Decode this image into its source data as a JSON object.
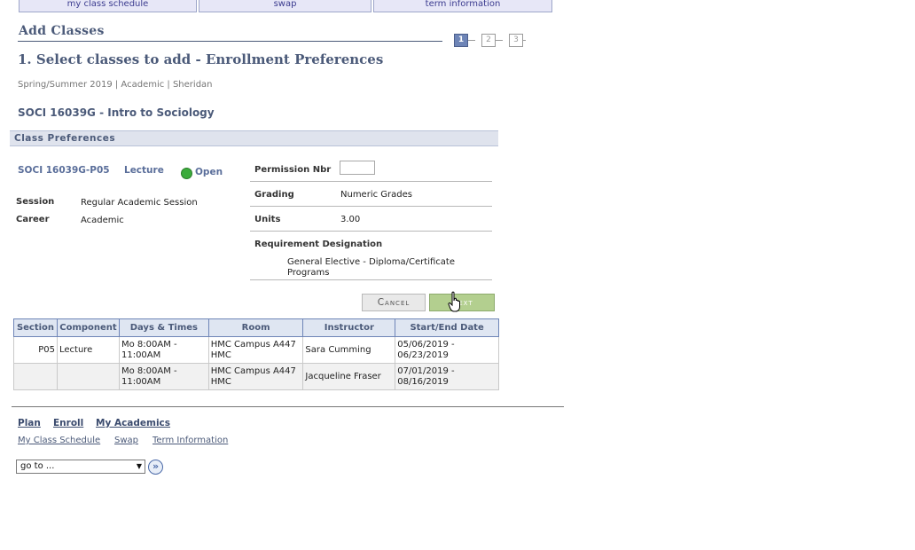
{
  "tabs": [
    {
      "label": "my class schedule"
    },
    {
      "label": "swap"
    },
    {
      "label": "term information"
    }
  ],
  "page": {
    "title": "Add Classes",
    "subtitle": "1.  Select classes to add - Enrollment Preferences",
    "term_line": "Spring/Summer 2019 | Academic | Sheridan",
    "course_title": "SOCI 16039G - Intro to Sociology"
  },
  "steps": [
    "1",
    "2",
    "3"
  ],
  "preferences": {
    "header": "Class Preferences",
    "section_link": "SOCI 16039G-P05",
    "component": "Lecture",
    "status": "Open",
    "session_label": "Session",
    "session_value": "Regular Academic Session",
    "career_label": "Career",
    "career_value": "Academic",
    "permission_label": "Permission Nbr",
    "grading_label": "Grading",
    "grading_value": "Numeric Grades",
    "units_label": "Units",
    "units_value": "3.00",
    "requirement_label": "Requirement Designation",
    "requirement_value": "General Elective - Diploma/Certificate Programs"
  },
  "buttons": {
    "cancel": "Cancel",
    "next": "Next"
  },
  "schedule": {
    "headers": [
      "Section",
      "Component",
      "Days & Times",
      "Room",
      "Instructor",
      "Start/End Date"
    ],
    "rows": [
      {
        "section": "P05",
        "component": "Lecture",
        "days_times": "Mo 8:00AM - 11:00AM",
        "room": "HMC Campus A447 HMC",
        "instructor": "Sara Cumming",
        "dates": "05/06/2019 - 06/23/2019"
      },
      {
        "section": "",
        "component": "",
        "days_times": "Mo 8:00AM - 11:00AM",
        "room": "HMC Campus A447 HMC",
        "instructor": "Jacqueline Fraser",
        "dates": "07/01/2019 - 08/16/2019"
      }
    ]
  },
  "footer_nav": {
    "primary": [
      "Plan",
      "Enroll",
      "My Academics"
    ],
    "secondary": [
      "My Class Schedule",
      "Swap",
      "Term Information"
    ],
    "goto": "go to ..."
  },
  "colors": {
    "heading": "#4b5a79",
    "header_bar": "#dfe3ed",
    "open_status": "#3bab3b",
    "next_button": "#b3cf8f"
  }
}
